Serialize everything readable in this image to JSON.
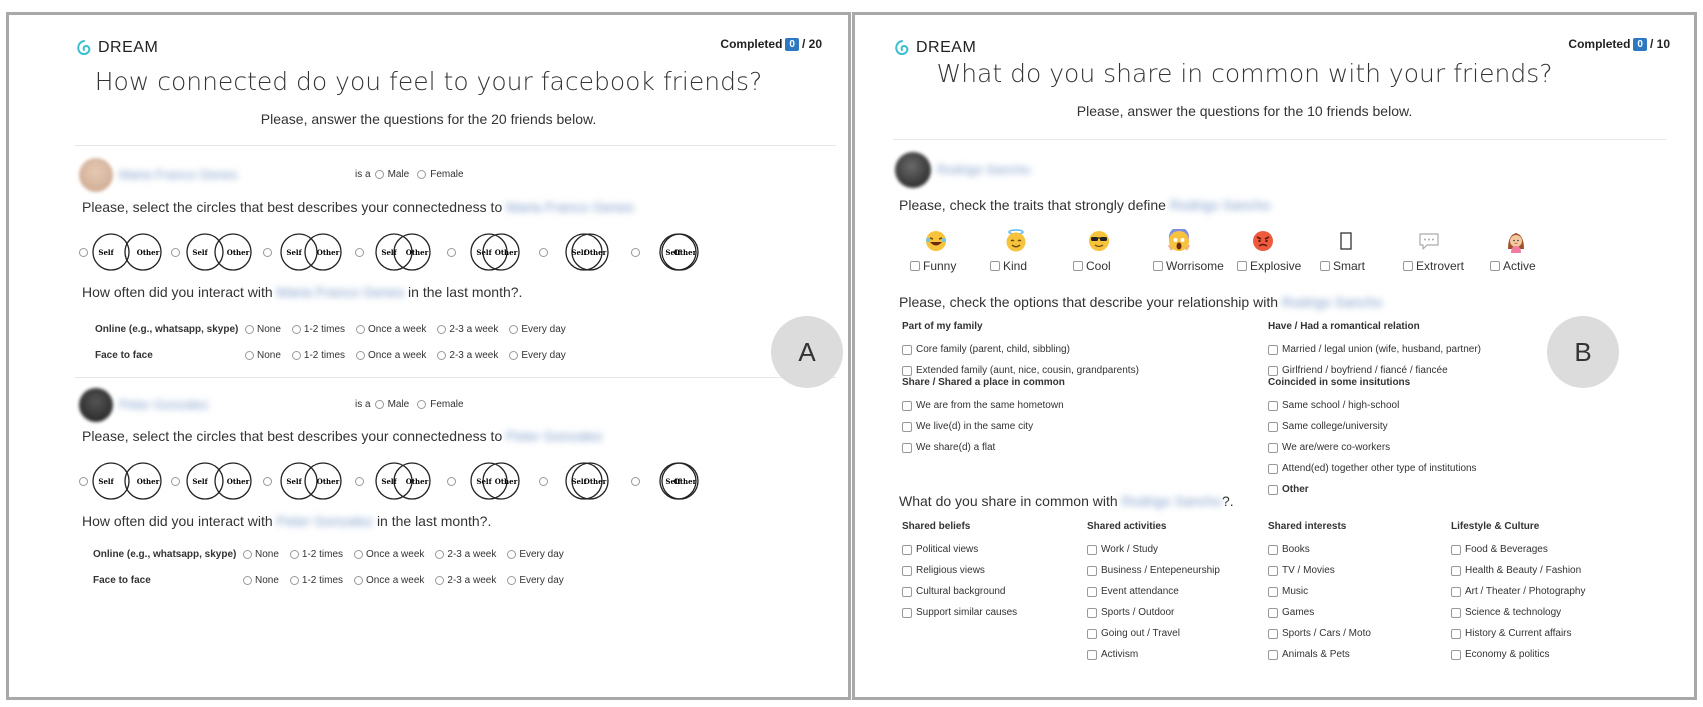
{
  "panel_a": {
    "logo": "DREAM",
    "completed": {
      "label": "Completed",
      "count": "0",
      "total": "/ 20"
    },
    "title": "How connected do you feel to your facebook friends?",
    "subtitle": "Please, answer the questions for the 20 friends below.",
    "gender_label": "is a",
    "gender_options": [
      "Male",
      "Female"
    ],
    "connectedness_question": "Please, select the circles that best describes your connectedness to",
    "circle_labels": {
      "self": "Self",
      "other": "Other"
    },
    "interact_question_prefix": "How often did you interact with",
    "interact_question_suffix": "in the last month?.",
    "frequency_rows": [
      "Online (e.g., whatsapp, skype)",
      "Face to face"
    ],
    "frequency_options": [
      "None",
      "1-2 times",
      "Once a week",
      "2-3 a week",
      "Every day"
    ],
    "friends": [
      {
        "name": "Maria Franco Genes"
      },
      {
        "name": "Peter Gonzalez"
      }
    ],
    "badge": "A"
  },
  "panel_b": {
    "logo": "DREAM",
    "completed": {
      "label": "Completed",
      "count": "0",
      "total": "/ 10"
    },
    "title": "What do you share in common with your friends?",
    "subtitle": "Please, answer the questions for the 10 friends below.",
    "friend_name": "Rodrigo Sancho",
    "traits_question": "Please, check the traits that strongly define",
    "traits": [
      {
        "label": "Funny",
        "icon": "laughing-emoji-icon"
      },
      {
        "label": "Kind",
        "icon": "angel-emoji-icon"
      },
      {
        "label": "Cool",
        "icon": "sunglasses-emoji-icon"
      },
      {
        "label": "Worrisome",
        "icon": "screaming-emoji-icon"
      },
      {
        "label": "Explosive",
        "icon": "angry-emoji-icon"
      },
      {
        "label": "Smart",
        "icon": "missing-glyph-icon"
      },
      {
        "label": "Extrovert",
        "icon": "speech-bubble-icon"
      },
      {
        "label": "Active",
        "icon": "woman-emoji-icon"
      }
    ],
    "relationship_question": "Please, check the options that describe your relationship with",
    "relationship_groups": [
      {
        "title": "Part of my family",
        "options": [
          "Core family (parent, child, sibbling)",
          "Extended family (aunt, nice, cousin, grandparents)"
        ]
      },
      {
        "title": "Share / Shared a place in common",
        "options": [
          "We are from the same hometown",
          "We live(d) in the same city",
          "We share(d) a flat"
        ]
      },
      {
        "title": "Have / Had a romantical relation",
        "options": [
          "Married / legal union (wife, husband, partner)",
          "Girlfriend / boyfriend / fiancé / fiancée"
        ]
      },
      {
        "title": "Coincided in some insitutions",
        "options": [
          "Same school / high-school",
          "Same college/university",
          "We are/were co-workers",
          "Attend(ed) together other type of institutions",
          "Other"
        ]
      }
    ],
    "common_question_prefix": "What do you share in common with",
    "common_question_suffix": "?.",
    "common_groups": [
      {
        "title": "Shared beliefs",
        "options": [
          "Political views",
          "Religious views",
          "Cultural background",
          "Support similar causes"
        ]
      },
      {
        "title": "Shared activities",
        "options": [
          "Work / Study",
          "Business / Entepeneurship",
          "Event attendance",
          "Sports / Outdoor",
          "Going out / Travel",
          "Activism"
        ]
      },
      {
        "title": "Shared interests",
        "options": [
          "Books",
          "TV / Movies",
          "Music",
          "Games",
          "Sports / Cars / Moto",
          "Animals & Pets"
        ]
      },
      {
        "title": "Lifestyle & Culture",
        "options": [
          "Food & Beverages",
          "Health & Beauty / Fashion",
          "Art / Theater / Photography",
          "Science & technology",
          "History & Current affairs",
          "Economy & politics"
        ]
      }
    ],
    "badge": "B"
  },
  "colors": {
    "accent": "#2e78c2",
    "logo": "#3bbfd1",
    "badge_bg": "#dcdcdc",
    "border": "#a8a8a8"
  }
}
